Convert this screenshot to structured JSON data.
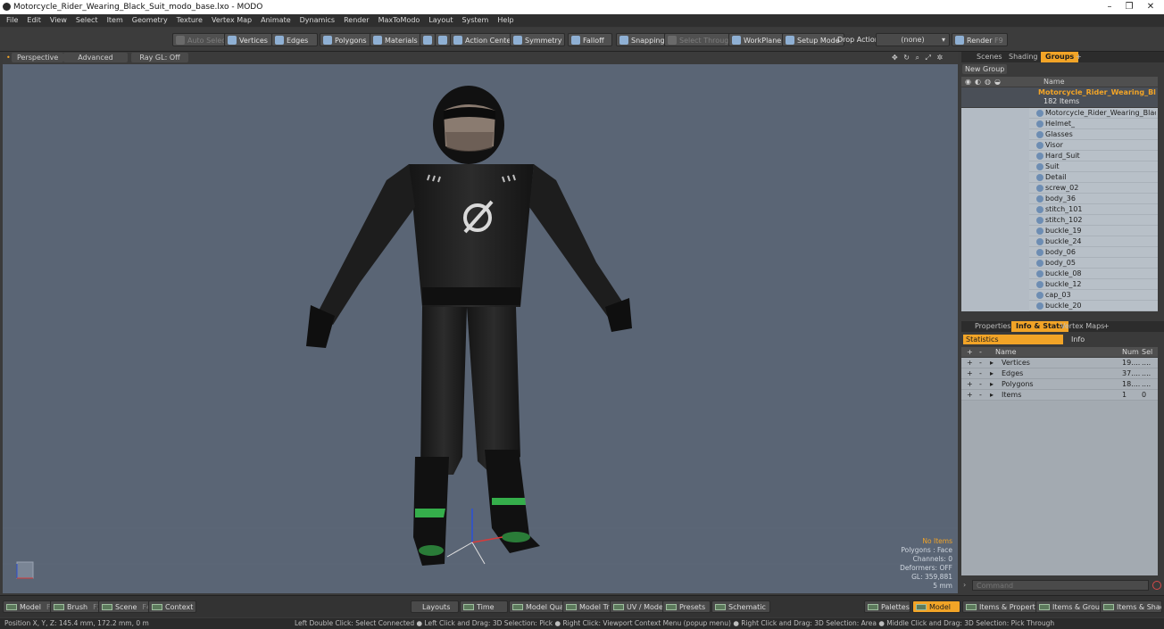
{
  "window": {
    "title": "Motorcycle_Rider_Wearing_Black_Suit_modo_base.lxo - MODO",
    "minimize": "–",
    "maximize": "❐",
    "close": "✕"
  },
  "menu": [
    "File",
    "Edit",
    "View",
    "Select",
    "Item",
    "Geometry",
    "Texture",
    "Vertex Map",
    "Animate",
    "Dynamics",
    "Render",
    "MaxToModo",
    "Layout",
    "System",
    "Help"
  ],
  "toolbar": {
    "auto_select": "Auto Select",
    "vertices": "Vertices",
    "edges": "Edges",
    "polygons": "Polygons",
    "materials": "Materials",
    "action_center": "Action Center",
    "symmetry": "Symmetry",
    "falloff": "Falloff",
    "snapping": "Snapping",
    "select_through": "Select Through",
    "workplane": "WorkPlane",
    "setup_mode": "Setup Mode",
    "drop_action": "Drop Action",
    "drop_value": "(none)",
    "render": "Render",
    "render_key": "F9"
  },
  "viewport": {
    "view": "Perspective",
    "advanced": "Advanced",
    "raygl": "Ray GL: Off",
    "stats": [
      "No Items",
      "Polygons : Face",
      "Channels: 0",
      "Deformers: OFF",
      "GL: 359,881",
      "5 mm"
    ]
  },
  "groups_panel": {
    "tabs": [
      "Scenes",
      "Shading",
      "Groups",
      "+"
    ],
    "new_group": "New Group",
    "name_header": "Name",
    "group_name": "Motorcycle_Rider_Wearing_Bla ...",
    "group_count": "182 Items",
    "items": [
      "Motorcycle_Rider_Wearing_Black_ ...",
      "Helmet_",
      "Glasses",
      "Visor",
      "Hard_Suit",
      "Suit",
      "Detail",
      "screw_02",
      "body_36",
      "stitch_101",
      "stitch_102",
      "buckle_19",
      "buckle_24",
      "body_06",
      "body_05",
      "buckle_08",
      "buckle_12",
      "cap_03",
      "buckle_20"
    ]
  },
  "info_panel": {
    "tabs": [
      "Properties",
      "Info & Stats",
      "Vertex Maps",
      "+"
    ],
    "statistics": "Statistics",
    "info": "Info",
    "headers": {
      "name": "Name",
      "num": "Num",
      "sel": "Sel"
    },
    "rows": [
      {
        "name": "Vertices",
        "num": "19....",
        "sel": "...."
      },
      {
        "name": "Edges",
        "num": "37....",
        "sel": "...."
      },
      {
        "name": "Polygons",
        "num": "18....",
        "sel": "...."
      },
      {
        "name": "Items",
        "num": "1",
        "sel": "0"
      }
    ],
    "command_placeholder": "Command"
  },
  "bottombar": {
    "model": "Model",
    "model_key": "F2",
    "brush": "Brush",
    "brush_key": "F3",
    "scene": "Scene",
    "scene_key": "F4",
    "context": "Context",
    "layouts": "Layouts",
    "time": "Time",
    "model_quad": "Model Quad",
    "model_tri": "Model Tri",
    "uv_model": "UV / Model",
    "presets": "Presets",
    "schematic": "Schematic",
    "palettes": "Palettes",
    "model_active": "Model",
    "items_properties": "Items & Properties",
    "items_groups": "Items & Groups",
    "items_shading": "Items & Shading"
  },
  "status": {
    "position": "Position X, Y, Z:   145.4 mm, 172.2 mm, 0 m",
    "hint": "Left Double Click: Select Connected ● Left Click and Drag: 3D Selection: Pick ● Right Click: Viewport Context Menu (popup menu) ● Right Click and Drag: 3D Selection: Area ● Middle Click and Drag: 3D Selection: Pick Through"
  },
  "colors": {
    "accent": "#f2a427",
    "viewport_bg": "#5a6575",
    "suit": "#1c1c1c",
    "boot_accent": "#3fd65a"
  }
}
